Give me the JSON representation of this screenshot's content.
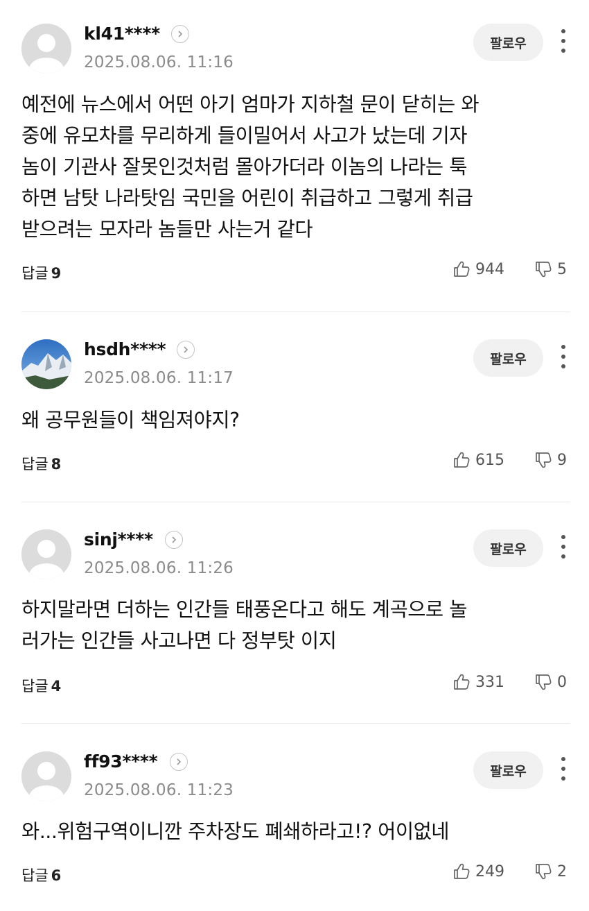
{
  "follow_label": "팔로우",
  "reply_label": "답글",
  "comments": [
    {
      "nickname": "kl41****",
      "date": "2025.08.06. 11:16",
      "text_lines": [
        "예전에 뉴스에서 어떤 아기 엄마가 지하철 문이 닫히는 와",
        "중에 유모차를 무리하게 들이밀어서 사고가 났는데 기자",
        "놈이 기관사 잘못인것처럼 몰아가더라 이놈의 나라는 툭",
        "하면 남탓 나라탓임 국민을 어린이 취급하고 그렇게 취급",
        "받으려는 모자라 놈들만 사는거 같다"
      ],
      "replies": "9",
      "likes": "944",
      "dislikes": "5"
    },
    {
      "nickname": "hsdh****",
      "date": "2025.08.06. 11:17",
      "text_lines": [
        "왜 공무원들이 책임져야지?"
      ],
      "replies": "8",
      "likes": "615",
      "dislikes": "9"
    },
    {
      "nickname": "sinj****",
      "date": "2025.08.06. 11:26",
      "text_lines": [
        "하지말라면 더하는 인간들 태풍온다고 해도 계곡으로 놀",
        "러가는 인간들 사고나면 다 정부탓 이지"
      ],
      "replies": "4",
      "likes": "331",
      "dislikes": "0"
    },
    {
      "nickname": "ff93****",
      "date": "2025.08.06. 11:23",
      "text_lines": [
        "와...위험구역이니깐 주차장도 폐쇄하라고!? 어이없네"
      ],
      "replies": "6",
      "likes": "249",
      "dislikes": "2"
    }
  ]
}
